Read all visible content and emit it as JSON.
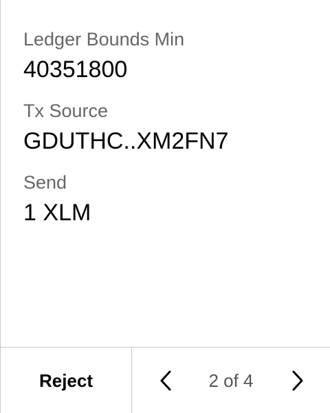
{
  "fields": [
    {
      "label": "Ledger Bounds Min",
      "value": "40351800"
    },
    {
      "label": "Tx Source",
      "value": "GDUTHC..XM2FN7"
    },
    {
      "label": "Send",
      "value": "1 XLM"
    }
  ],
  "footer": {
    "reject_label": "Reject",
    "page_indicator": "2 of 4",
    "prev_icon": "chevron-left-icon",
    "next_icon": "chevron-right-icon"
  },
  "colors": {
    "label": "#666666",
    "value": "#000000",
    "divider": "#c9c9c9"
  }
}
